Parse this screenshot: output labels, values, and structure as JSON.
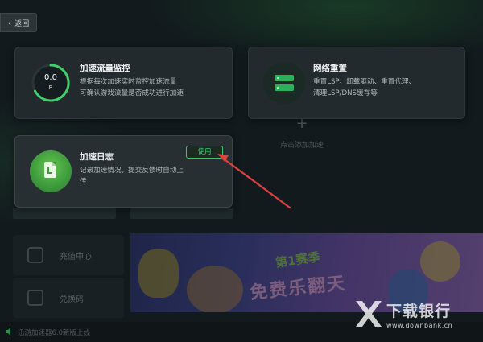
{
  "back_button": {
    "label": "返回"
  },
  "cards": {
    "traffic": {
      "gauge_value": "0.0",
      "gauge_unit": "B",
      "title": "加速流量监控",
      "desc_line1": "根据每次加速实时监控加速流量",
      "desc_line2": "可确认游戏流量是否成功进行加速"
    },
    "reset": {
      "title": "网络重置",
      "desc_line1": "重置LSP、卸载驱动、重置代理、",
      "desc_line2": "清理LSP/DNS缓存等"
    },
    "log": {
      "title": "加速日志",
      "use_label": "使用",
      "desc_line1": "记录加速情况，提交反馈时自动上",
      "desc_line2": "传"
    }
  },
  "background": {
    "add_label": "点击添加加速",
    "side_items": [
      "充值中心",
      "兑换码"
    ],
    "banner_title": "第1赛季",
    "banner_subtitle": "免费乐翻天",
    "status_text": "迅游加速器6.0新版上线"
  },
  "watermark": {
    "name": "下载银行",
    "url": "www.downbank.cn"
  },
  "colors": {
    "accent_green": "#49d07a",
    "arrow_red": "#e0403f",
    "card_bg": "#232a2e"
  }
}
